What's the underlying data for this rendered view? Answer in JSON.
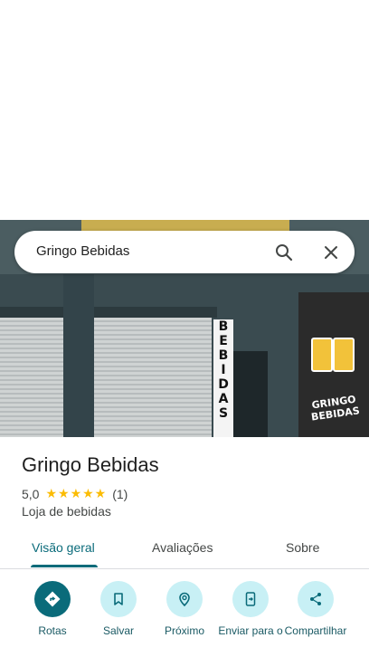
{
  "search": {
    "query": "Gringo Bebidas",
    "search_icon": "search-icon",
    "close_icon": "close-icon"
  },
  "photo": {
    "storefront_sign": "BEBIDAS",
    "mural_text": "GRINGO BEBIDAS"
  },
  "place": {
    "name": "Gringo Bebidas",
    "rating": "5,0",
    "stars": "★★★★★",
    "review_count": "(1)",
    "category": "Loja de bebidas"
  },
  "tabs": [
    {
      "label": "Visão geral",
      "active": true
    },
    {
      "label": "Avaliações",
      "active": false
    },
    {
      "label": "Sobre",
      "active": false
    }
  ],
  "actions": [
    {
      "label": "Rotas",
      "icon": "directions-icon"
    },
    {
      "label": "Salvar",
      "icon": "bookmark-icon"
    },
    {
      "label": "Próximo",
      "icon": "nearby-icon"
    },
    {
      "label": "Enviar para o",
      "icon": "send-to-phone-icon"
    },
    {
      "label": "Compartilhar",
      "icon": "share-icon"
    }
  ],
  "colors": {
    "accent": "#0a6b7a",
    "chip_bg": "#c8f0f5",
    "star": "#fbbc04"
  }
}
